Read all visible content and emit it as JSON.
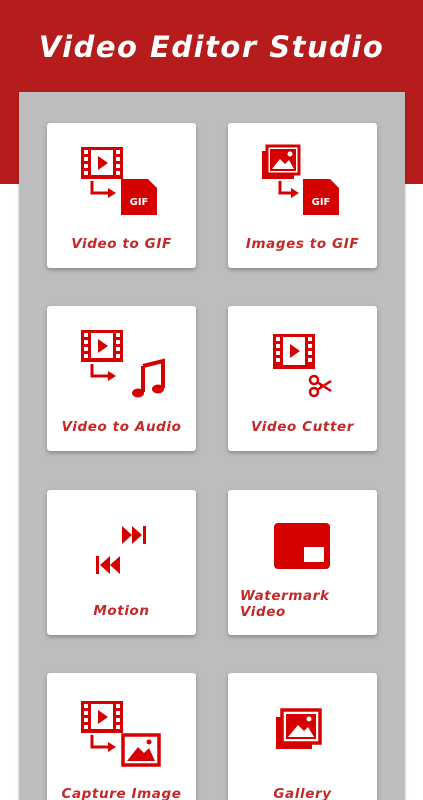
{
  "app": {
    "title": "Video Editor Studio"
  },
  "colors": {
    "brand": "#b71c1c",
    "icon": "#d50000",
    "label": "#c62828",
    "panel": "#bdbdbd"
  },
  "menu": {
    "items": [
      {
        "label": "Video to GIF",
        "icon": "video-to-gif-icon"
      },
      {
        "label": "Images to GIF",
        "icon": "images-to-gif-icon"
      },
      {
        "label": "Video to Audio",
        "icon": "video-to-audio-icon"
      },
      {
        "label": "Video Cutter",
        "icon": "video-cutter-icon"
      },
      {
        "label": "Motion",
        "icon": "motion-icon"
      },
      {
        "label": "Watermark\nVideo",
        "icon": "watermark-icon"
      },
      {
        "label": "Capture Image",
        "icon": "capture-image-icon"
      },
      {
        "label": "Gallery",
        "icon": "gallery-icon"
      }
    ]
  }
}
